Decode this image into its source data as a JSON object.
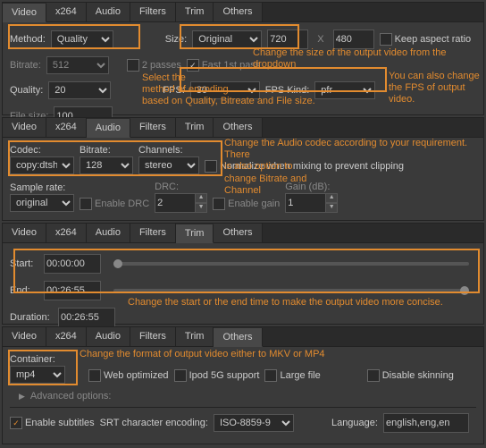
{
  "tabs": {
    "video": "Video",
    "x264": "x264",
    "audio": "Audio",
    "filters": "Filters",
    "trim": "Trim",
    "others": "Others"
  },
  "p1": {
    "method_lbl": "Method:",
    "method_val": "Quality",
    "bitrate_lbl": "Bitrate:",
    "bitrate_val": "512",
    "quality_lbl": "Quality:",
    "quality_val": "20",
    "filesize_lbl": "File size:",
    "filesize_val": "100",
    "twopass": "2 passes",
    "fast1st": "Fast 1st pass",
    "size_lbl": "Size:",
    "size_val": "Original",
    "w": "720",
    "h": "480",
    "keepasp": "Keep aspect ratio",
    "fps_lbl": "FPS:",
    "fps_val": "30",
    "fpskind_lbl": "FPS Kind:",
    "fpskind_val": "pfr",
    "annot1": "Change the size of the output video from the dropdown",
    "annot2": "Select the\nmethod of encoding\nbased on Quality, Bitreate and File size.",
    "annot3": "You can also change\nthe FPS of output\nvideo."
  },
  "p2": {
    "codec_lbl": "Codec:",
    "codec_val": "copy:dtshd",
    "bitrate_lbl": "Bitrate:",
    "bitrate_val": "128",
    "channels_lbl": "Channels:",
    "channels_val": "stereo",
    "normalize": "Normalize when mixing to prevent clipping",
    "sample_lbl": "Sample rate:",
    "sample_val": "original",
    "enabledrc": "Enable DRC",
    "drc_lbl": "DRC:",
    "drc_val": "2",
    "enablegain": "Enable gain",
    "gain_lbl": "Gain (dB):",
    "gain_val": "1",
    "annot": "Change the Audio codec according to your requirement. There\nis also option to\nchange Bitrate and\nChannel"
  },
  "p3": {
    "start_lbl": "Start:",
    "start_val": "00:00:00",
    "end_lbl": "End:",
    "end_val": "00:26:55",
    "dur_lbl": "Duration:",
    "dur_val": "00:26:55",
    "annot": "Change the start or the end time to make the output video more concise."
  },
  "p4": {
    "container_lbl": "Container:",
    "container_val": "mp4",
    "webopt": "Web optimized",
    "ipod": "Ipod 5G support",
    "large": "Large file",
    "disableskin": "Disable skinning",
    "advopt": "Advanced options:",
    "enablesub": "Enable subtitles",
    "srt_lbl": "SRT character encoding:",
    "srt_val": "ISO-8859-9",
    "lang_lbl": "Language:",
    "lang_val": "english,eng,en",
    "annot": "Change the format of output video either to MKV or MP4"
  }
}
